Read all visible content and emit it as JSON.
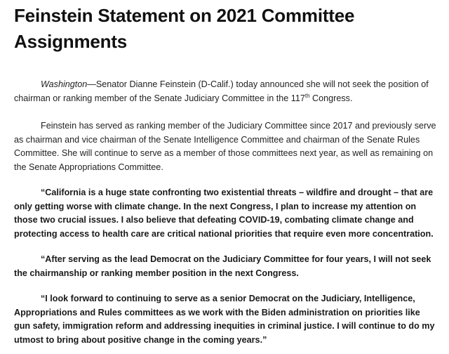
{
  "document": {
    "title": "Feinstein Statement on 2021 Committee Assignments",
    "paragraph1": {
      "dateline": "Washington",
      "text_before_sup": "—Senator Dianne Feinstein (D-Calif.) today announced she will not seek the position of chairman or ranking member of the Senate Judiciary Committee in the 117",
      "sup": "th",
      "text_after_sup": " Congress."
    },
    "paragraph2": "Feinstein has served as ranking member of the Judiciary Committee since 2017 and previously serve as chairman and vice chairman of the Senate Intelligence Committee and chairman of the Senate Rules Committee. She will continue to serve as a member of those committees next year, as well as remaining on the Senate Appropriations Committee.",
    "quote1": "“California is a huge state confronting two existential threats – wildfire and drought – that are only getting worse with climate change. In the next Congress, I plan to increase my attention on those two crucial issues. I also believe that defeating COVID-19, combating climate change and protecting access to health care are critical national priorities that require even more concentration.",
    "quote2": "“After serving as the lead Democrat on the Judiciary Committee for four years, I will not seek the chairmanship or ranking member position in the next Congress.",
    "quote3": "“I look forward to continuing to serve as a senior Democrat on the Judiciary, Intelligence, Appropriations and Rules committees as we work with the Biden administration on priorities like gun safety, immigration reform and addressing inequities in criminal justice. I will continue to do my utmost to bring about positive change in the coming years.”"
  }
}
